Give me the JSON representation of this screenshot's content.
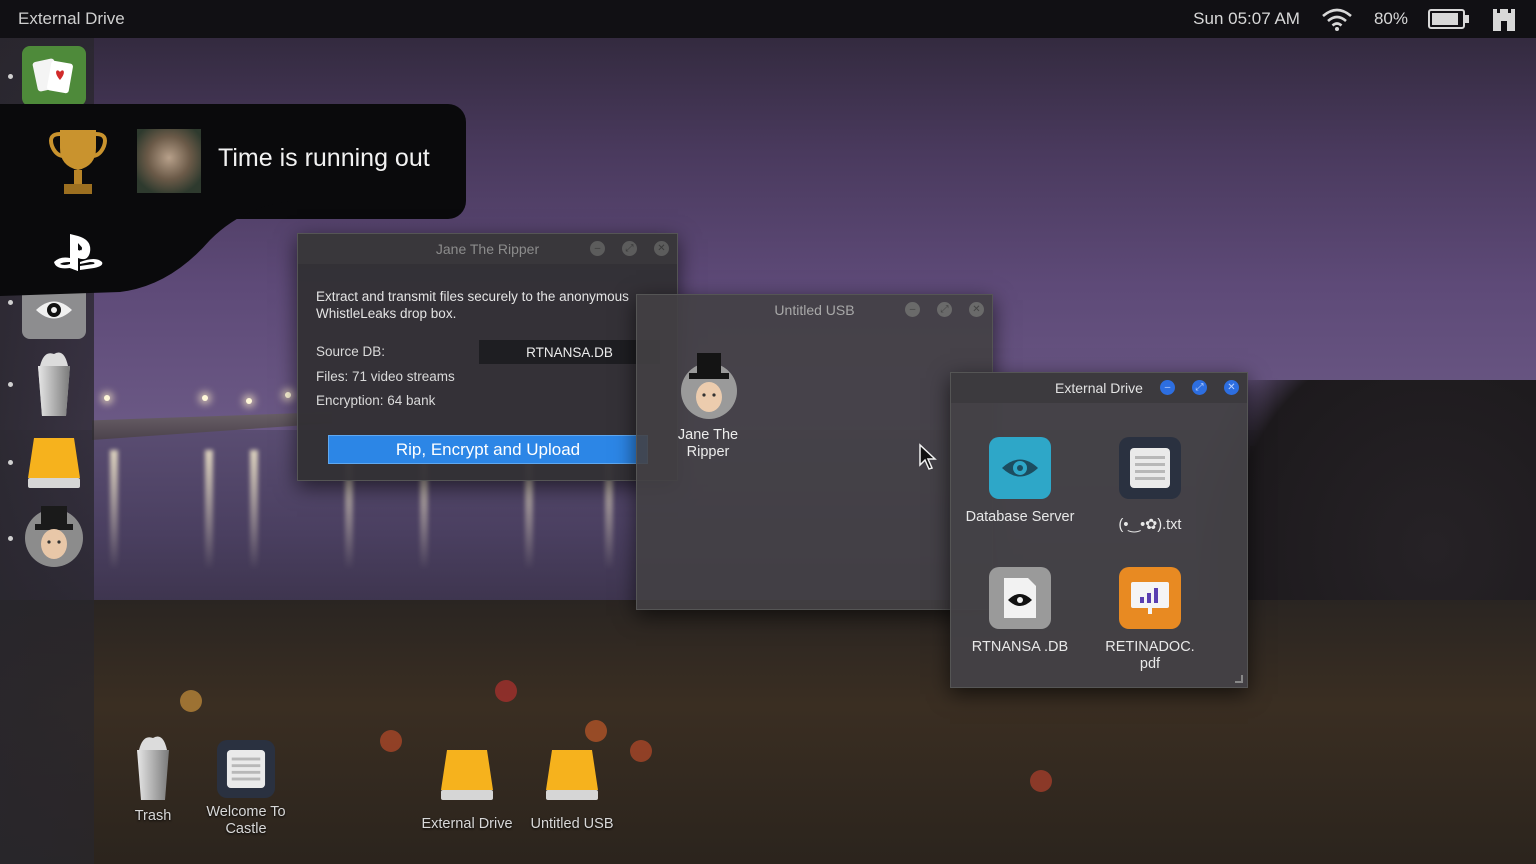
{
  "topbar": {
    "app_title": "External Drive",
    "datetime": "Sun 05:07 AM",
    "battery_percent": "80%",
    "icons": [
      "wifi-icon",
      "battery-icon",
      "castle-icon"
    ]
  },
  "notification": {
    "text": "Time is running out",
    "icons": [
      "trophy-icon",
      "playstation-icon"
    ]
  },
  "dock": {
    "items": [
      "solitaire",
      "database-server",
      "trash",
      "external-drive",
      "jane-the-ripper"
    ]
  },
  "jane_window": {
    "title": "Jane The Ripper",
    "description": "Extract and transmit files securely to the anonymous WhistleLeaks drop box.",
    "source_label": "Source DB:",
    "source_value": "RTNANSA.DB",
    "files": "Files: 71 video streams",
    "encryption": "Encryption: 64 bank",
    "button": "Rip, Encrypt and Upload"
  },
  "usb_window": {
    "title": "Untitled USB",
    "item_label": "Jane The Ripper"
  },
  "ext_window": {
    "title": "External Drive",
    "items": [
      {
        "label": "Database Server",
        "icon": "eye-icon",
        "color": "#2ea7c8"
      },
      {
        "label": "(•‿•✿).txt",
        "icon": "text-file-icon",
        "color": "#2a3140"
      },
      {
        "label": "RTNANSA .DB",
        "icon": "db-file-icon",
        "color": "#9a9a9a"
      },
      {
        "label": "RETINADOC. pdf",
        "icon": "pdf-icon",
        "color": "#e88a22"
      }
    ]
  },
  "desktop": {
    "items": [
      {
        "label": "Trash"
      },
      {
        "label": "Welcome To Castle"
      },
      {
        "label": "External Drive"
      },
      {
        "label": "Untitled USB"
      }
    ]
  },
  "colors": {
    "accent_blue": "#2c86e6",
    "topbar_bg": "#111014"
  }
}
